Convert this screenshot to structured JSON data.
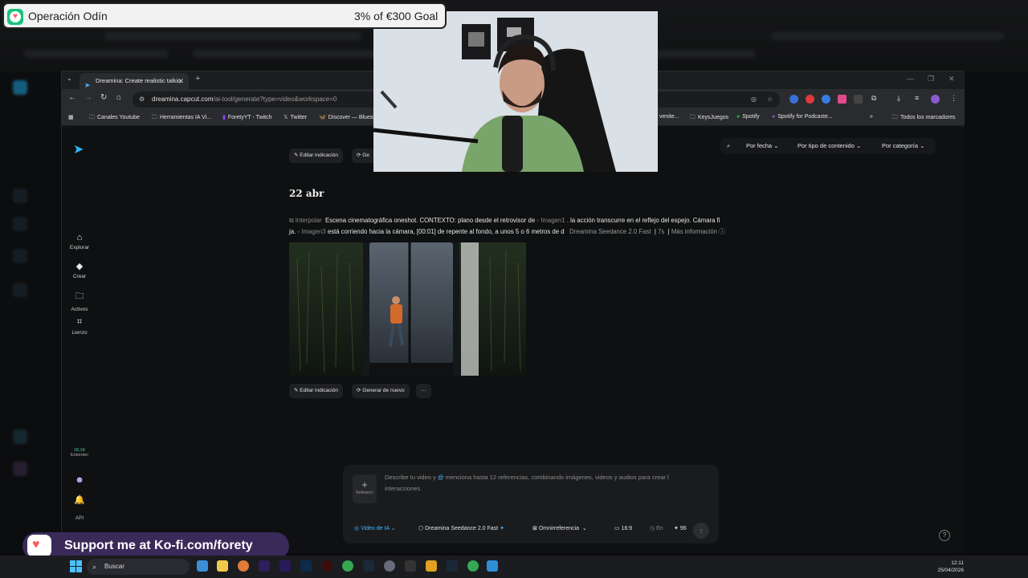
{
  "overlay": {
    "goal_title": "Operación Odín",
    "goal_amount": "3% of €300 Goal",
    "goal_progress": 0.03,
    "support_text": "Support me at Ko-fi.com/forety"
  },
  "browser": {
    "tab_title": "Dreamina: Create realistic talkin",
    "url_host": "dreamina.capcut.com",
    "url_path": "/ai-tool/generate?type=video&workspace=0",
    "bookmarks": [
      {
        "label": "Canales Youtube",
        "icon": "folder-icon"
      },
      {
        "label": "Herramientas IA Vi...",
        "icon": "folder-icon"
      },
      {
        "label": "ForetyYT - Twitch",
        "icon": "twitch-icon"
      },
      {
        "label": "Twitter",
        "icon": "x-icon"
      },
      {
        "label": "Discover — Blueski",
        "icon": "bluesky-icon"
      },
      {
        "label": "venite...",
        "icon": "link-icon"
      },
      {
        "label": "KeysJuegos",
        "icon": "folder-icon"
      },
      {
        "label": "Spotify",
        "icon": "spotify-icon"
      },
      {
        "label": "Spotify for Podcaste...",
        "icon": "spotify-icon"
      }
    ],
    "all_bookmarks": "Todos los marcadores"
  },
  "sidebar": {
    "items": [
      {
        "label": "Explorar",
        "icon": "home-icon"
      },
      {
        "label": "Crear",
        "icon": "diamond-icon"
      },
      {
        "label": "Activos",
        "icon": "folder-icon"
      },
      {
        "label": "Lienzo",
        "icon": "canvas-icon"
      }
    ],
    "credits": "18,1K",
    "credits_label": "Entender",
    "api": "API"
  },
  "filters": {
    "by_date": "Por fecha",
    "by_type": "Por tipo de contenido",
    "by_category": "Por categoría"
  },
  "top_actions": {
    "edit": "Editar indicación",
    "regen": "Ge"
  },
  "feed": {
    "date": "22 abr",
    "prompt_tag": "Interpolar",
    "prompt_line1": "Escena cinematográfica oneshot. CONTEXTO: plano desde el retrovisor de",
    "ref1": "Imagen1",
    "prompt_line1b": ". la acción transcurre en el reflejo del espejo. Cámara fi",
    "prompt_line2a": "ja.",
    "ref3": "Imagen3",
    "prompt_line2b": "está corriendo hacia la cámara, [00:01] de repente al fondo, a unos 5 o 6 metros de d",
    "model": "Dreamina Seedance 2.0 Fast",
    "duration": "7s",
    "more_info": "Más información",
    "edit": "Editar indicación",
    "regen": "Generar de nuevo",
    "more": "···"
  },
  "composer": {
    "ref_label": "Referenci",
    "placeholder_a": "Describe tu video y",
    "placeholder_b": "menciona hasta 12 referencias, combinando imágenes, videos y audios para crear l",
    "placeholder_c": "nteracciones",
    "mode": "Video de IA",
    "model": "Dreamina Seedance 2.0 Fast",
    "reference": "Omnirreferencia",
    "ratio": "16:9",
    "duration": "En",
    "credits": "96"
  },
  "taskbar": {
    "search": "Buscar",
    "time": "12:11",
    "date": "25/04/2026"
  },
  "colors": {
    "accent": "#4db6ff",
    "kofi_green": "#19c37d",
    "kofi_red": "#ff5e5b"
  }
}
